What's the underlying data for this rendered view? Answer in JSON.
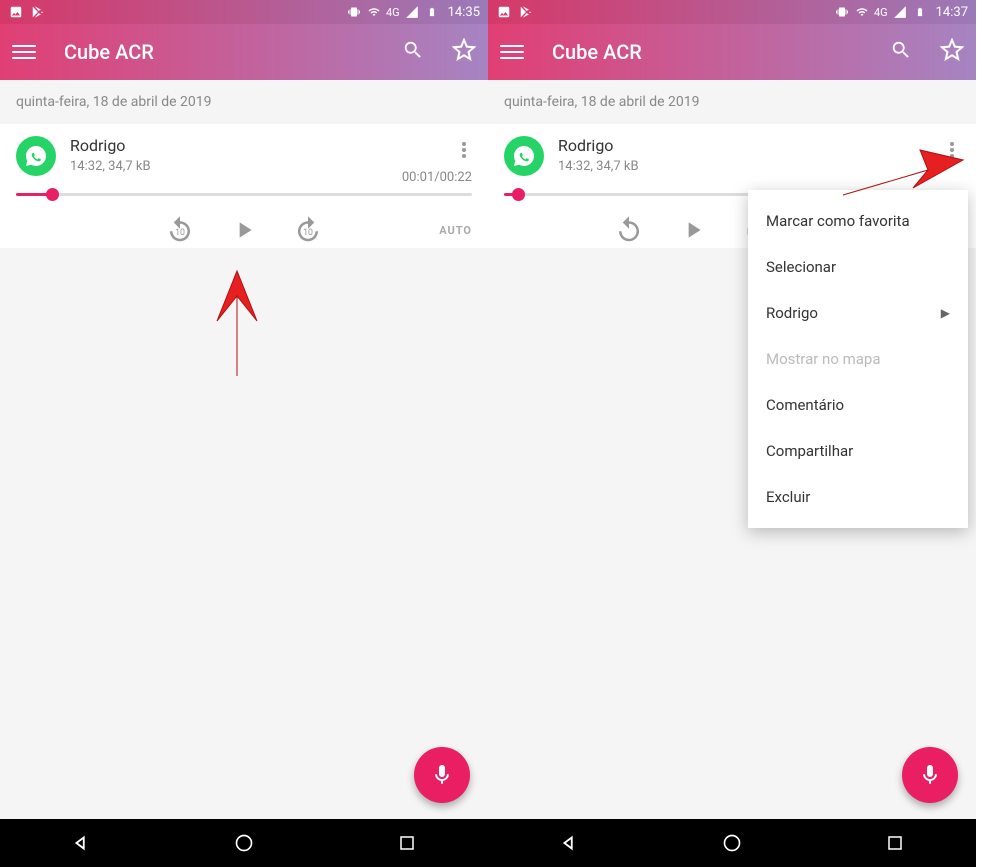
{
  "status": {
    "network_label": "4G",
    "time_left": "14:35",
    "time_right": "14:37"
  },
  "app": {
    "title": "Cube ACR"
  },
  "date_header": "quinta-feira, 18 de abril de 2019",
  "recording": {
    "contact": "Rodrigo",
    "time": "14:32",
    "size": "34,7 kB",
    "playback": "00:01/00:22",
    "progress_percent_left": 8,
    "progress_percent_right": 3,
    "auto_label": "AUTO"
  },
  "menu": {
    "items": [
      {
        "label": "Marcar como favorita",
        "disabled": false,
        "submenu": false
      },
      {
        "label": "Selecionar",
        "disabled": false,
        "submenu": false
      },
      {
        "label": "Rodrigo",
        "disabled": false,
        "submenu": true
      },
      {
        "label": "Mostrar no mapa",
        "disabled": true,
        "submenu": false
      },
      {
        "label": "Comentário",
        "disabled": false,
        "submenu": false
      },
      {
        "label": "Compartilhar",
        "disabled": false,
        "submenu": false
      },
      {
        "label": "Excluir",
        "disabled": false,
        "submenu": false
      }
    ]
  }
}
